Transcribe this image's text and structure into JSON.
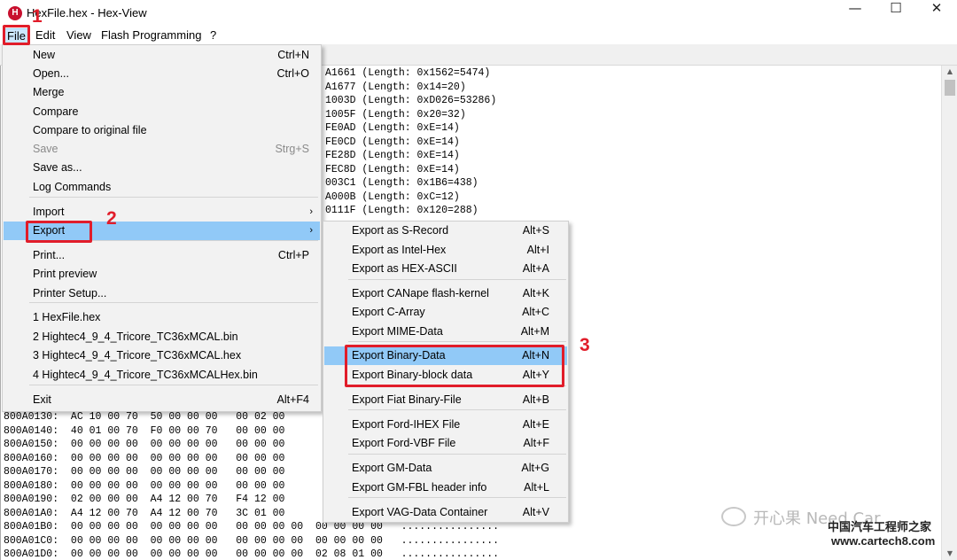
{
  "window": {
    "title": "HexFile.hex - Hex-View",
    "app_icon_letter": "H",
    "minimize": "—",
    "maximize": "☐",
    "close": "✕"
  },
  "menubar": [
    "File",
    "Edit",
    "View",
    "Flash Programming",
    "?"
  ],
  "log_lines": [
    "A1661 (Length: 0x1562=5474)",
    "A1677 (Length: 0x14=20)",
    "1003D (Length: 0xD026=53286)",
    "1005F (Length: 0x20=32)",
    "FE0AD (Length: 0xE=14)",
    "FE0CD (Length: 0xE=14)",
    "FE28D (Length: 0xE=14)",
    "FEC8D (Length: 0xE=14)",
    "003C1 (Length: 0x1B6=438)",
    "A000B (Length: 0xC=12)",
    "0111F (Length: 0x120=288)"
  ],
  "hex_lines": [
    "800A0130:  AC 10 00 70  50 00 00 00   00 02 00",
    "800A0140:  40 01 00 70  F0 00 00 70   00 00 00",
    "800A0150:  00 00 00 00  00 00 00 00   00 00 00",
    "800A0160:  00 00 00 00  00 00 00 00   00 00 00",
    "800A0170:  00 00 00 00  00 00 00 00   00 00 00",
    "800A0180:  00 00 00 00  00 00 00 00   00 00 00",
    "800A0190:  02 00 00 00  A4 12 00 70   F4 12 00",
    "800A01A0:  A4 12 00 70  A4 12 00 70   3C 01 00",
    "800A01B0:  00 00 00 00  00 00 00 00   00 00 00 00  00 00 00 00   ................",
    "800A01C0:  00 00 00 00  00 00 00 00   00 00 00 00  00 00 00 00   ................",
    "800A01D0:  00 00 00 00  00 00 00 00   00 00 00 00  02 08 01 00   ................"
  ],
  "file_menu": [
    {
      "label": "New",
      "shortcut": "Ctrl+N"
    },
    {
      "label": "Open...",
      "shortcut": "Ctrl+O"
    },
    {
      "label": "Merge",
      "shortcut": ""
    },
    {
      "label": "Compare",
      "shortcut": ""
    },
    {
      "label": "Compare to original file",
      "shortcut": ""
    },
    {
      "label": "Save",
      "shortcut": "Strg+S",
      "disabled": true
    },
    {
      "label": "Save as...",
      "shortcut": ""
    },
    {
      "label": "Log Commands",
      "shortcut": ""
    },
    {
      "label": "Import",
      "shortcut": "",
      "submenu": true
    },
    {
      "label": "Export",
      "shortcut": "",
      "submenu": true,
      "highlighted": true
    },
    {
      "label": "Print...",
      "shortcut": "Ctrl+P"
    },
    {
      "label": "Print preview",
      "shortcut": ""
    },
    {
      "label": "Printer Setup...",
      "shortcut": ""
    },
    {
      "label": "1 HexFile.hex",
      "shortcut": ""
    },
    {
      "label": "2 Hightec4_9_4_Tricore_TC36xMCAL.bin",
      "shortcut": ""
    },
    {
      "label": "3 Hightec4_9_4_Tricore_TC36xMCAL.hex",
      "shortcut": ""
    },
    {
      "label": "4 Hightec4_9_4_Tricore_TC36xMCALHex.bin",
      "shortcut": ""
    },
    {
      "label": "Exit",
      "shortcut": "Alt+F4"
    }
  ],
  "export_menu": [
    {
      "label": "Export as S-Record",
      "shortcut": "Alt+S"
    },
    {
      "label": "Export as Intel-Hex",
      "shortcut": "Alt+I"
    },
    {
      "label": "Export as HEX-ASCII",
      "shortcut": "Alt+A"
    },
    {
      "label": "Export CANape flash-kernel",
      "shortcut": "Alt+K"
    },
    {
      "label": "Export C-Array",
      "shortcut": "Alt+C"
    },
    {
      "label": "Export MIME-Data",
      "shortcut": "Alt+M"
    },
    {
      "label": "Export Binary-Data",
      "shortcut": "Alt+N",
      "highlighted": true
    },
    {
      "label": "Export Binary-block data",
      "shortcut": "Alt+Y"
    },
    {
      "label": "Export Fiat Binary-File",
      "shortcut": "Alt+B"
    },
    {
      "label": "Export Ford-IHEX File",
      "shortcut": "Alt+E"
    },
    {
      "label": "Export Ford-VBF File",
      "shortcut": "Alt+F"
    },
    {
      "label": "Export GM-Data",
      "shortcut": "Alt+G"
    },
    {
      "label": "Export GM-FBL header info",
      "shortcut": "Alt+L"
    },
    {
      "label": "Export VAG-Data Container",
      "shortcut": "Alt+V"
    }
  ],
  "annotations": [
    "1",
    "2",
    "3"
  ],
  "watermark": {
    "text": "开心果 Need Car",
    "site_cn": "中国汽车工程师之家",
    "site_url": "www.cartech8.com"
  },
  "colors": {
    "highlight": "#91c9f7",
    "annotation_red": "#e11d2a",
    "app_icon": "#c8102e"
  }
}
